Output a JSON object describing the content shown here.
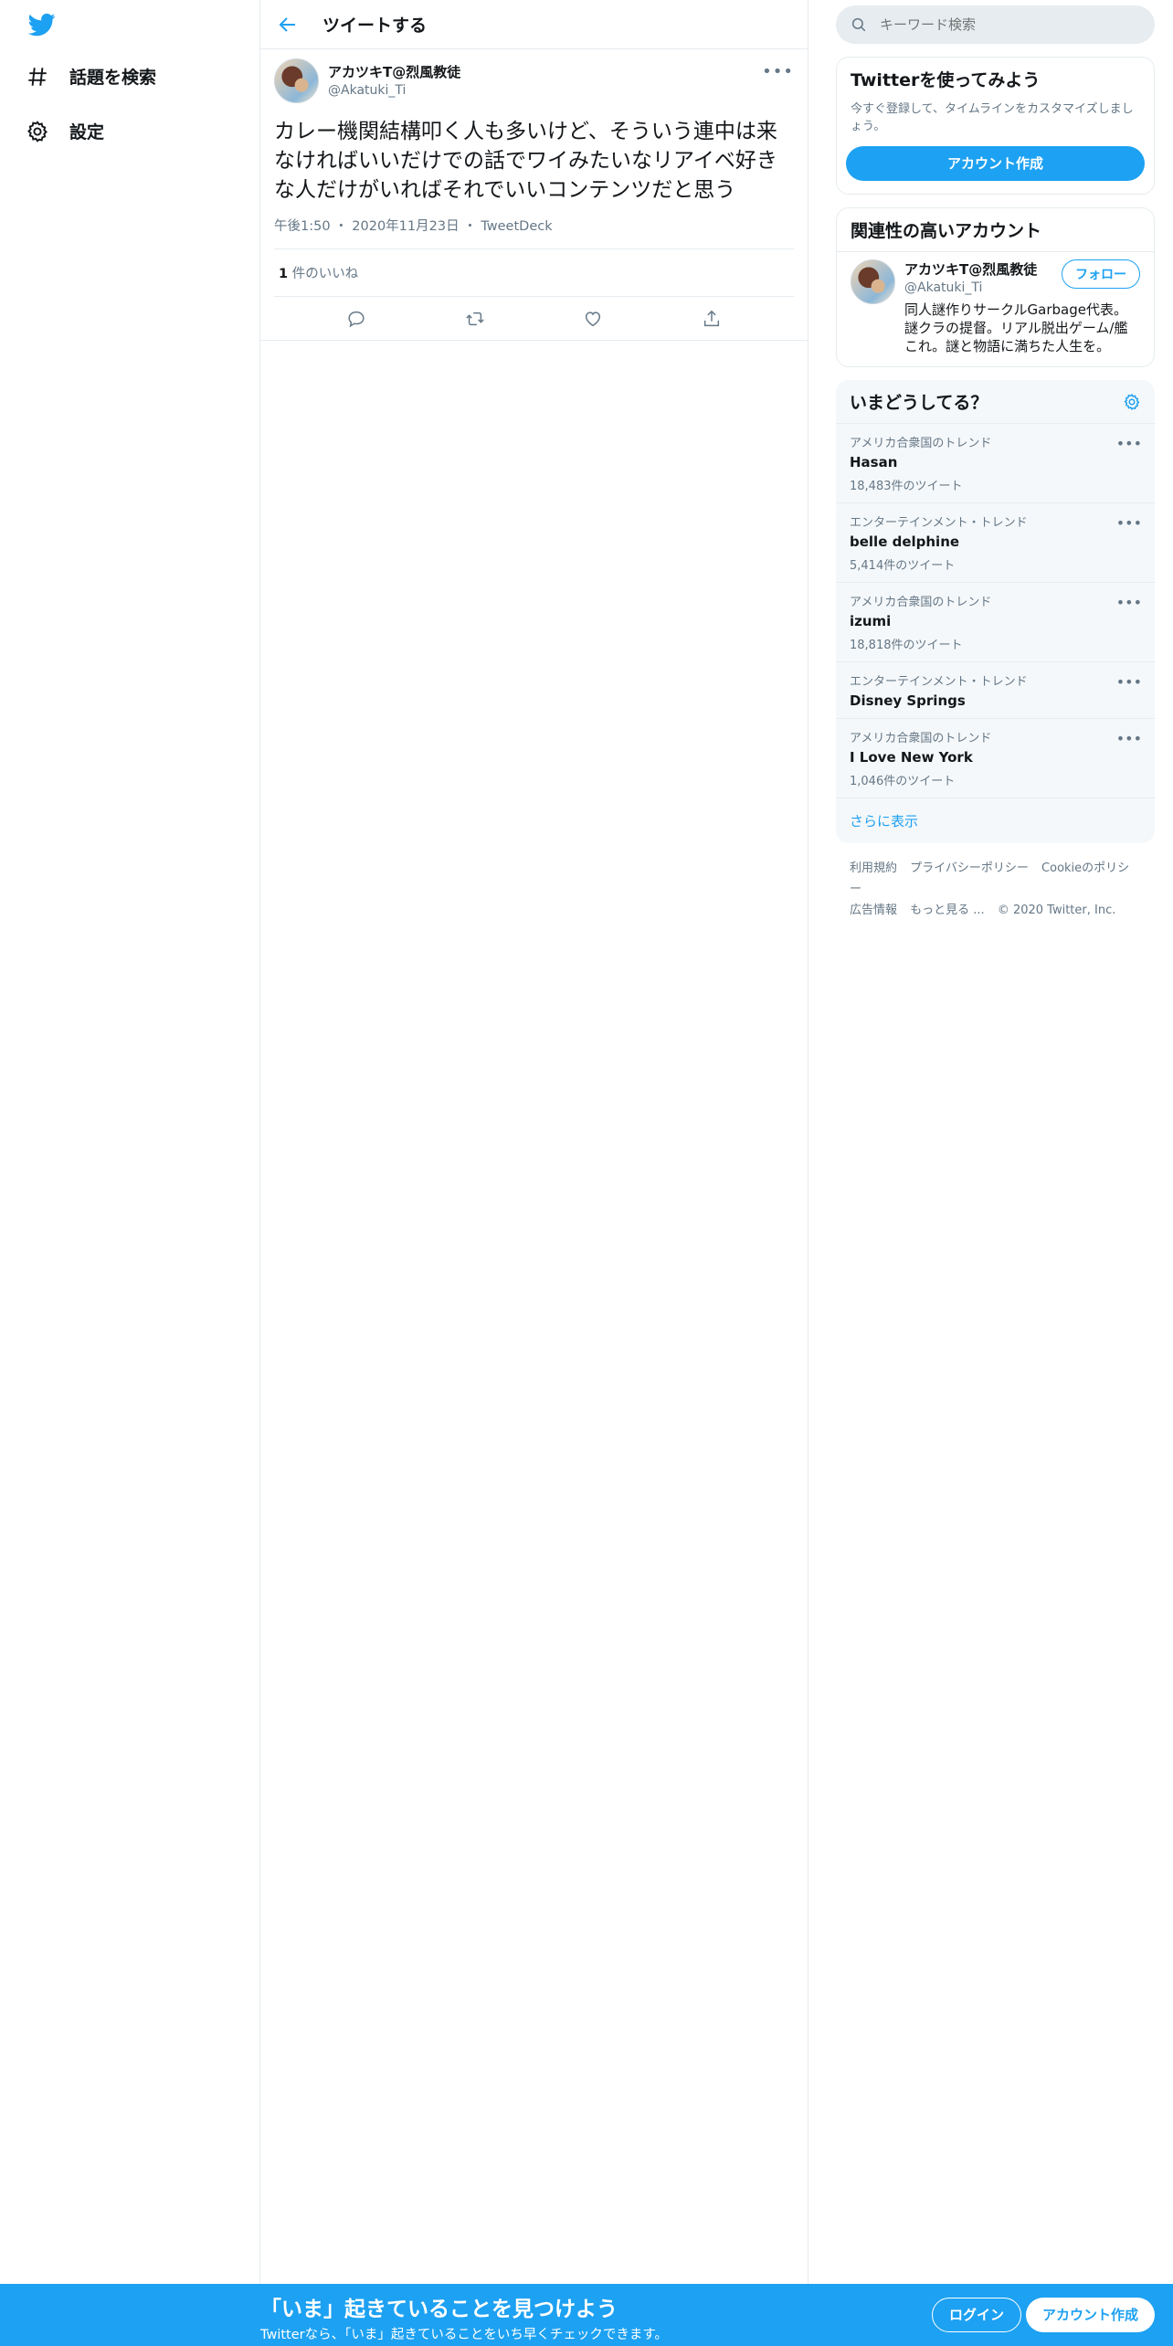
{
  "nav": {
    "logo": "twitter-bird-icon",
    "items": [
      {
        "label": "話題を検索",
        "icon": "hashtag-icon"
      },
      {
        "label": "設定",
        "icon": "gear-icon"
      }
    ]
  },
  "header": {
    "title": "ツイートする"
  },
  "tweet": {
    "author_name": "アカツキT@烈風教徒",
    "author_handle": "@Akatuki_Ti",
    "text": "カレー機関結構叩く人も多いけど、そういう連中は来なければいいだけでの話でワイみたいなリアイベ好きな人だけがいればそれでいいコンテンツだと思う",
    "time": "午後1:50",
    "date": "2020年11月23日",
    "source": "TweetDeck",
    "separator": "・",
    "likes_count": "1",
    "likes_label": " 件のいいね",
    "more": "•••"
  },
  "search": {
    "placeholder": "キーワード検索"
  },
  "signup_card": {
    "title": "Twitterを使ってみよう",
    "desc": "今すぐ登録して、タイムラインをカスタマイズしましょう。",
    "button": "アカウント作成"
  },
  "related": {
    "title": "関連性の高いアカウント",
    "name": "アカツキT@烈風教徒",
    "handle": "@Akatuki_Ti",
    "follow": "フォロー",
    "bio": "同人謎作りサークルGarbage代表。謎クラの提督。リアル脱出ゲーム/艦これ。謎と物語に満ちた人生を。"
  },
  "trends": {
    "title": "いまどうしてる？",
    "items": [
      {
        "context": "アメリカ合衆国のトレンド",
        "name": "Hasan",
        "count": "18,483件のツイート"
      },
      {
        "context": "エンターテインメント・トレンド",
        "name": "belle delphine",
        "count": "5,414件のツイート"
      },
      {
        "context": "アメリカ合衆国のトレンド",
        "name": "izumi",
        "count": "18,818件のツイート"
      },
      {
        "context": "エンターテインメント・トレンド",
        "name": "Disney Springs",
        "count": ""
      },
      {
        "context": "アメリカ合衆国のトレンド",
        "name": "I Love New York",
        "count": "1,046件のツイート"
      }
    ],
    "show_more": "さらに表示"
  },
  "footer": {
    "links": [
      "利用規約",
      "プライバシーポリシー",
      "Cookieのポリシー",
      "広告情報",
      "もっと見る ..."
    ],
    "copyright": "© 2020 Twitter, Inc."
  },
  "bottom_bar": {
    "title": "「いま」起きていることを見つけよう",
    "subtitle": "Twitterなら、「いま」起きていることをいち早くチェックできます。",
    "login": "ログイン",
    "signup": "アカウント作成"
  },
  "colors": {
    "accent": "#1da1f2",
    "text": "#14171a",
    "muted": "#657786",
    "border": "#e6ecf0"
  }
}
